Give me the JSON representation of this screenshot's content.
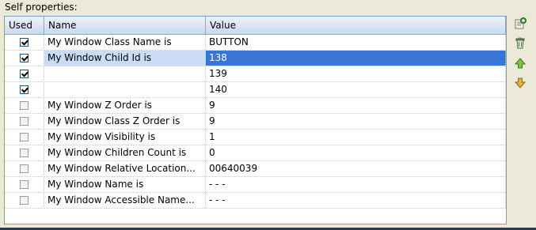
{
  "section_label": "Self properties:",
  "columns": {
    "used": "Used",
    "name": "Name",
    "value": "Value"
  },
  "rows": [
    {
      "checked": true,
      "name": "My Window Class Name is",
      "value": "BUTTON",
      "selected": false
    },
    {
      "checked": true,
      "name": "My Window Child Id is",
      "value": "138",
      "selected": true
    },
    {
      "checked": true,
      "name": "",
      "value": "139",
      "selected": false
    },
    {
      "checked": true,
      "name": "",
      "value": "140",
      "selected": false
    },
    {
      "checked": false,
      "name": "My Window Z Order is",
      "value": "9",
      "selected": false
    },
    {
      "checked": false,
      "name": "My Window Class Z Order is",
      "value": "9",
      "selected": false
    },
    {
      "checked": false,
      "name": "My Window Visibility is",
      "value": "1",
      "selected": false
    },
    {
      "checked": false,
      "name": "My Window Children Count is",
      "value": "0",
      "selected": false
    },
    {
      "checked": false,
      "name": "My Window Relative Location...",
      "value": "00640039",
      "selected": false
    },
    {
      "checked": false,
      "name": "My Window Name is",
      "value": "- - -",
      "selected": false
    },
    {
      "checked": false,
      "name": "My Window Accessible Name...",
      "value": "- - -",
      "selected": false
    }
  ],
  "toolbar": [
    {
      "name": "add-property-button",
      "icon": "add-property-icon"
    },
    {
      "name": "delete-button",
      "icon": "trash-icon"
    },
    {
      "name": "move-up-button",
      "icon": "arrow-up-icon"
    },
    {
      "name": "move-down-button",
      "icon": "arrow-down-icon"
    }
  ]
}
